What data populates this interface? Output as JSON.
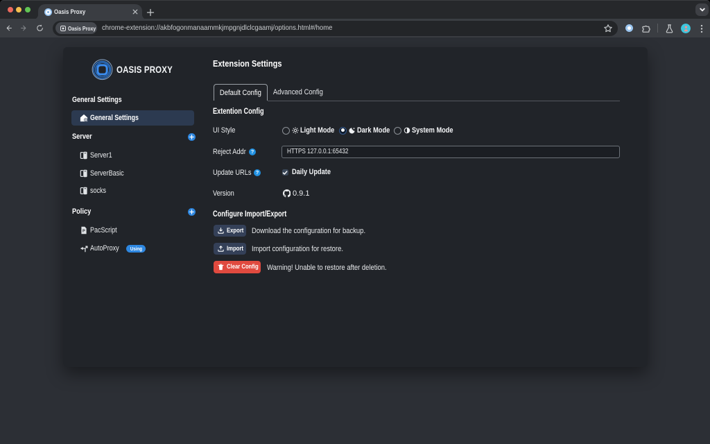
{
  "browser": {
    "tab_title": "Oasis Proxy",
    "chip_label": "Oasis Proxy",
    "url": "chrome-extension://akbfogonmanaammkjmpgnjdlclcgaamj/options.html#/home"
  },
  "sidebar": {
    "logo_text": "OASIS PROXY",
    "groups": [
      {
        "label": "General Settings",
        "items": [
          {
            "label": "General Settings",
            "active": true
          }
        ]
      },
      {
        "label": "Server",
        "items": [
          {
            "label": "Server1"
          },
          {
            "label": "ServerBasic"
          },
          {
            "label": "socks"
          }
        ]
      },
      {
        "label": "Policy",
        "items": [
          {
            "label": "PacScript"
          },
          {
            "label": "AutoProxy",
            "badge": "Using"
          }
        ]
      }
    ]
  },
  "main": {
    "title": "Extension Settings",
    "tabs": [
      {
        "label": "Default Config",
        "active": true
      },
      {
        "label": "Advanced Config"
      }
    ],
    "section_config": "Extention Config",
    "ui_style": {
      "label": "UI Style",
      "options": [
        {
          "label": "Light Mode",
          "checked": false
        },
        {
          "label": "Dark Mode",
          "checked": true
        },
        {
          "label": "System Mode",
          "checked": false
        }
      ]
    },
    "reject_addr": {
      "label": "Reject Addr",
      "value": "HTTPS 127.0.0.1:65432"
    },
    "update_urls": {
      "label": "Update URLs",
      "checkbox_label": "Daily Update",
      "checked": true
    },
    "version": {
      "label": "Version",
      "value": "0.9.1"
    },
    "section_import_export": "Configure Import/Export",
    "actions": [
      {
        "button": "Export",
        "desc": "Download the configuration for backup."
      },
      {
        "button": "Import",
        "desc": "Import configuration for restore."
      },
      {
        "button": "Clear Config",
        "desc": "Warning! Unable to restore after deletion."
      }
    ]
  },
  "colors": {
    "accent_blue": "#2e87e0",
    "danger_red": "#e04a3f",
    "card_bg": "#212429",
    "page_bg": "#2c2f35",
    "selected_item_bg": "#2c3a50"
  }
}
